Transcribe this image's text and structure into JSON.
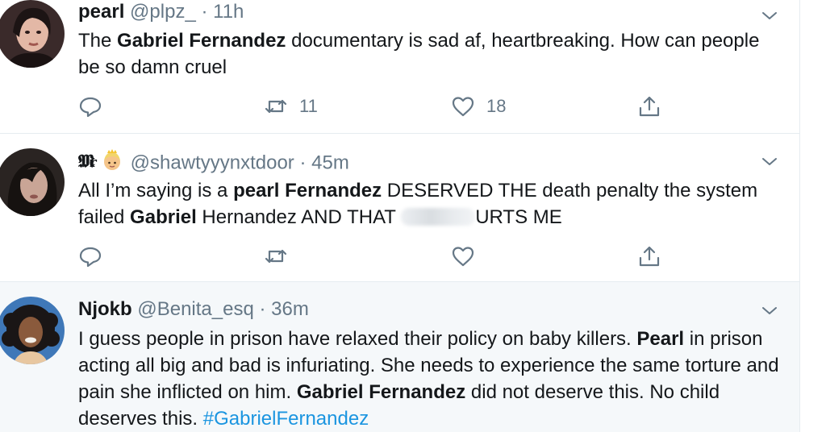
{
  "tweets": [
    {
      "name": "pearl",
      "handle": "@plpz_",
      "dot": "·",
      "time": "11h",
      "text": {
        "p1": "The ",
        "b1": "Gabriel Fernandez",
        "p2": " documentary is sad af, heartbreaking. How can people be so damn cruel"
      },
      "replies": "",
      "retweets": "11",
      "likes": "18"
    },
    {
      "name_icon": "fraktur-m-and-princess-emoji",
      "name": "",
      "handle": "@shawtyyynxtdoor",
      "dot": "·",
      "time": "45m",
      "text": {
        "p1": "All I’m saying is a ",
        "b1": "pearl Fernandez",
        "p2": " DESERVED THE death penalty the system failed ",
        "b2": "Gabriel",
        "p3": " Hernandez AND THAT ",
        "p4": "URTS ME"
      },
      "replies": "",
      "retweets": "",
      "likes": ""
    },
    {
      "name": "Njokb",
      "handle": "@Benita_esq",
      "dot": "·",
      "time": "36m",
      "text": {
        "p1": "I guess people in prison have relaxed their policy on baby killers. ",
        "b1": "Pearl",
        "p2": " in prison acting all big and bad is infuriating. She needs to experience the same torture and pain she inflicted on him. ",
        "b2": "Gabriel Fernandez",
        "p3": " did not deserve this. No child deserves this. ",
        "hashtag": "#GabrielFernandez"
      }
    }
  ],
  "icons": {
    "reply": "reply-icon",
    "retweet": "retweet-icon",
    "like": "heart-icon",
    "share": "share-icon",
    "caret": "chevron-down-icon"
  },
  "colors": {
    "text": "#14171a",
    "secondary": "#657786",
    "link": "#1b95e0",
    "highlight_bg": "#f5f8fa",
    "divider": "#e6ecf0"
  }
}
